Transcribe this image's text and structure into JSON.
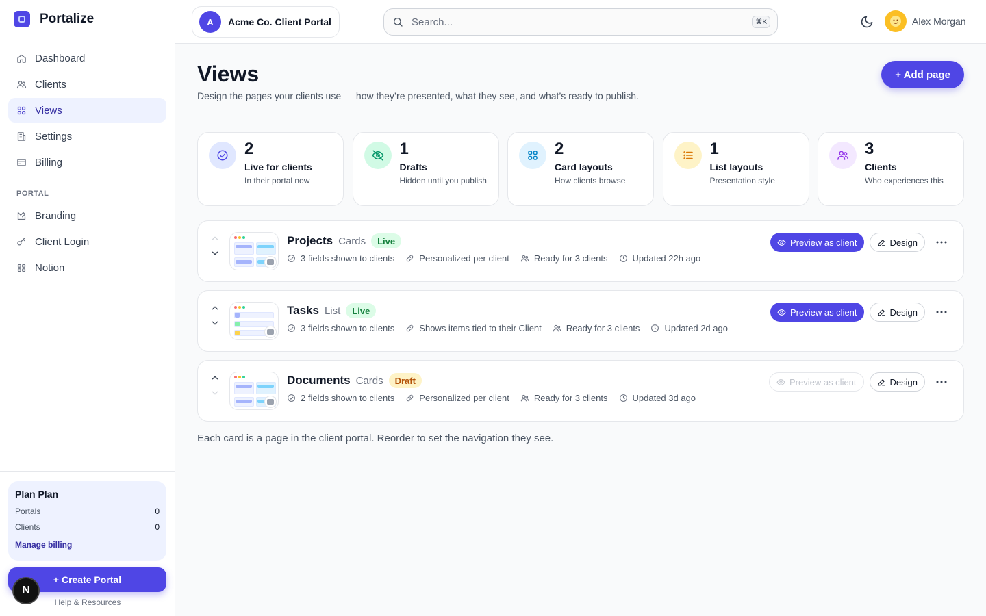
{
  "app": {
    "brand": "Portalize"
  },
  "sidebar": {
    "items": [
      {
        "label": "Dashboard",
        "icon": "home-icon"
      },
      {
        "label": "Clients",
        "icon": "users-icon"
      },
      {
        "label": "Views",
        "icon": "grid-icon",
        "active": true
      },
      {
        "label": "Settings",
        "icon": "building-icon"
      },
      {
        "label": "Billing",
        "icon": "card-icon"
      }
    ],
    "portal_section": "PORTAL",
    "portal_items": [
      {
        "label": "Branding",
        "icon": "palette-icon"
      },
      {
        "label": "Client Login",
        "icon": "key-icon"
      },
      {
        "label": "Notion",
        "icon": "grid-icon"
      }
    ],
    "plan": {
      "title": "Plan Plan",
      "rows": [
        {
          "label": "Portals",
          "value": "0"
        },
        {
          "label": "Clients",
          "value": "0"
        }
      ],
      "manage_label": "Manage billing"
    },
    "create_label": "+ Create Portal",
    "help_label": "Help & Resources",
    "n_badge": "N"
  },
  "header": {
    "portal_initial": "A",
    "portal_name": "Acme Co. Client Portal",
    "search_placeholder": "Search...",
    "search_kbd": "⌘K",
    "user_name": "Alex Morgan"
  },
  "main": {
    "title": "Views",
    "subtitle": "Design the pages your clients use — how they’re presented, what they see, and what’s ready to publish.",
    "add_label": "+ Add page",
    "stats": [
      {
        "value": "2",
        "label": "Live for clients",
        "sub": "In their portal now",
        "icon": "check-circle-icon",
        "bg": "#e0e7ff",
        "fg": "#4f46e5"
      },
      {
        "value": "1",
        "label": "Drafts",
        "sub": "Hidden until you publish",
        "icon": "eye-off-icon",
        "bg": "#d1fae5",
        "fg": "#059669"
      },
      {
        "value": "2",
        "label": "Card layouts",
        "sub": "How clients browse",
        "icon": "grid-icon",
        "bg": "#e0f2fe",
        "fg": "#0284c7"
      },
      {
        "value": "1",
        "label": "List layouts",
        "sub": "Presentation style",
        "icon": "list-icon",
        "bg": "#fef3c7",
        "fg": "#d97706"
      },
      {
        "value": "3",
        "label": "Clients",
        "sub": "Who experiences this",
        "icon": "users-icon",
        "bg": "#f3e8ff",
        "fg": "#9333ea"
      }
    ],
    "views": [
      {
        "name": "Projects",
        "type": "Cards",
        "status": "Live",
        "fields": "3 fields shown to clients",
        "scope": "Personalized per client",
        "ready": "Ready for 3 clients",
        "updated": "Updated 22h ago",
        "preview": "Preview as client",
        "design": "Design",
        "layout": "cards",
        "up_disabled": true,
        "down_disabled": false,
        "preview_disabled": false
      },
      {
        "name": "Tasks",
        "type": "List",
        "status": "Live",
        "fields": "3 fields shown to clients",
        "scope": "Shows items tied to their Client",
        "ready": "Ready for 3 clients",
        "updated": "Updated 2d ago",
        "preview": "Preview as client",
        "design": "Design",
        "layout": "list",
        "up_disabled": false,
        "down_disabled": false,
        "preview_disabled": false
      },
      {
        "name": "Documents",
        "type": "Cards",
        "status": "Draft",
        "fields": "2 fields shown to clients",
        "scope": "Personalized per client",
        "ready": "Ready for 3 clients",
        "updated": "Updated 3d ago",
        "preview": "Preview as client",
        "design": "Design",
        "layout": "cards",
        "up_disabled": false,
        "down_disabled": true,
        "preview_disabled": true
      }
    ],
    "footer_note": "Each card is a page in the client portal. Reorder to set the navigation they see."
  },
  "colors": {
    "accent": "#4f46e5",
    "live": "#15803d",
    "draft": "#b45309"
  }
}
